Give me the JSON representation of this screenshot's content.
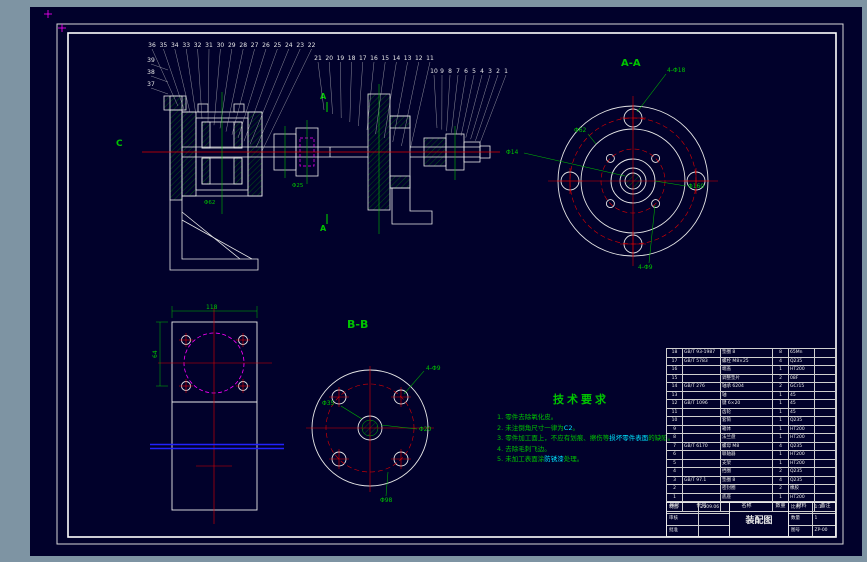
{
  "labels": {
    "section_c": "C",
    "section_a": "A"
  },
  "assembly": {
    "callout_rows": [
      [
        "36",
        "35",
        "34",
        "33",
        "32",
        "31",
        "30",
        "29",
        "28",
        "27",
        "26",
        "25",
        "24",
        "23",
        "22"
      ],
      [
        "21",
        "20",
        "19",
        "18",
        "17",
        "16",
        "15",
        "14",
        "13",
        "12",
        "11"
      ],
      [
        "10",
        "9",
        "8",
        "7",
        "6",
        "5",
        "4",
        "3",
        "2",
        "1"
      ],
      [
        "39",
        "38",
        "37"
      ]
    ],
    "dims": [
      "Φ62",
      "Φ25"
    ]
  },
  "aa": {
    "label": "A-A",
    "dims": {
      "top": "4-Φ18",
      "left": "Φ14",
      "mid": "Φ62",
      "right": "Φ160",
      "bottom": "4-Φ9"
    }
  },
  "bb": {
    "label": "B-B",
    "dims": {
      "top": "4-Φ9",
      "right": "Φ20",
      "bottom": "Φ98",
      "left": "Φ35"
    }
  },
  "plate": {
    "dim_top": "118",
    "dim_left": "64"
  },
  "tech": {
    "title": "技术要求",
    "l1": "1. 零件去除氧化皮。",
    "l2a": "2. 未注倒角尺寸一律为",
    "l2b": "C2",
    "l2c": "。",
    "l3a": "3. 零件加工面上，不应有划痕、擦伤等",
    "l3b": "损坏零件表面",
    "l3c": "的缺陷。",
    "l4": "4. 去除毛刺飞边。",
    "l5a": "5. 未加工表面涂",
    "l5b": "防锈漆",
    "l5c": "处理。"
  },
  "bom": {
    "header": [
      "序号",
      "代号",
      "名称",
      "数量",
      "材料",
      "备注"
    ],
    "rows": [
      [
        "18",
        "GB/T 93-1987",
        "垫圈 8",
        "8",
        "65Mn",
        ""
      ],
      [
        "17",
        "GB/T 5783",
        "螺栓 M8×25",
        "4",
        "Q235",
        ""
      ],
      [
        "16",
        "",
        "端盖",
        "1",
        "HT200",
        ""
      ],
      [
        "15",
        "",
        "调整垫片",
        "2",
        "08F",
        ""
      ],
      [
        "14",
        "GB/T 276",
        "轴承 6204",
        "2",
        "GCr15",
        ""
      ],
      [
        "13",
        "",
        "轴",
        "1",
        "45",
        ""
      ],
      [
        "12",
        "GB/T 1096",
        "键 6×20",
        "1",
        "45",
        ""
      ],
      [
        "11",
        "",
        "齿轮",
        "1",
        "45",
        ""
      ],
      [
        "10",
        "",
        "套筒",
        "1",
        "Q235",
        ""
      ],
      [
        "9",
        "",
        "箱体",
        "1",
        "HT200",
        ""
      ],
      [
        "8",
        "",
        "法兰盘",
        "1",
        "HT200",
        ""
      ],
      [
        "7",
        "GB/T 6170",
        "螺母 M8",
        "4",
        "Q235",
        ""
      ],
      [
        "6",
        "",
        "联轴器",
        "1",
        "HT200",
        ""
      ],
      [
        "5",
        "",
        "支架",
        "1",
        "HT200",
        ""
      ],
      [
        "4",
        "",
        "挡圈",
        "2",
        "Q235",
        ""
      ],
      [
        "3",
        "GB/T 97.1",
        "垫圈 8",
        "4",
        "Q235",
        ""
      ],
      [
        "2",
        "",
        "密封圈",
        "2",
        "橡胶",
        ""
      ],
      [
        "1",
        "",
        "底座",
        "1",
        "HT200",
        ""
      ]
    ]
  },
  "titleblock": {
    "title": "装配图",
    "rows_left": [
      [
        "制图",
        "2009.06"
      ],
      [
        "审核",
        ""
      ],
      [
        "批准",
        ""
      ]
    ],
    "rows_right": [
      [
        "比例",
        "1:1"
      ],
      [
        "数量",
        "1"
      ],
      [
        "图号",
        "ZP-00"
      ]
    ]
  }
}
